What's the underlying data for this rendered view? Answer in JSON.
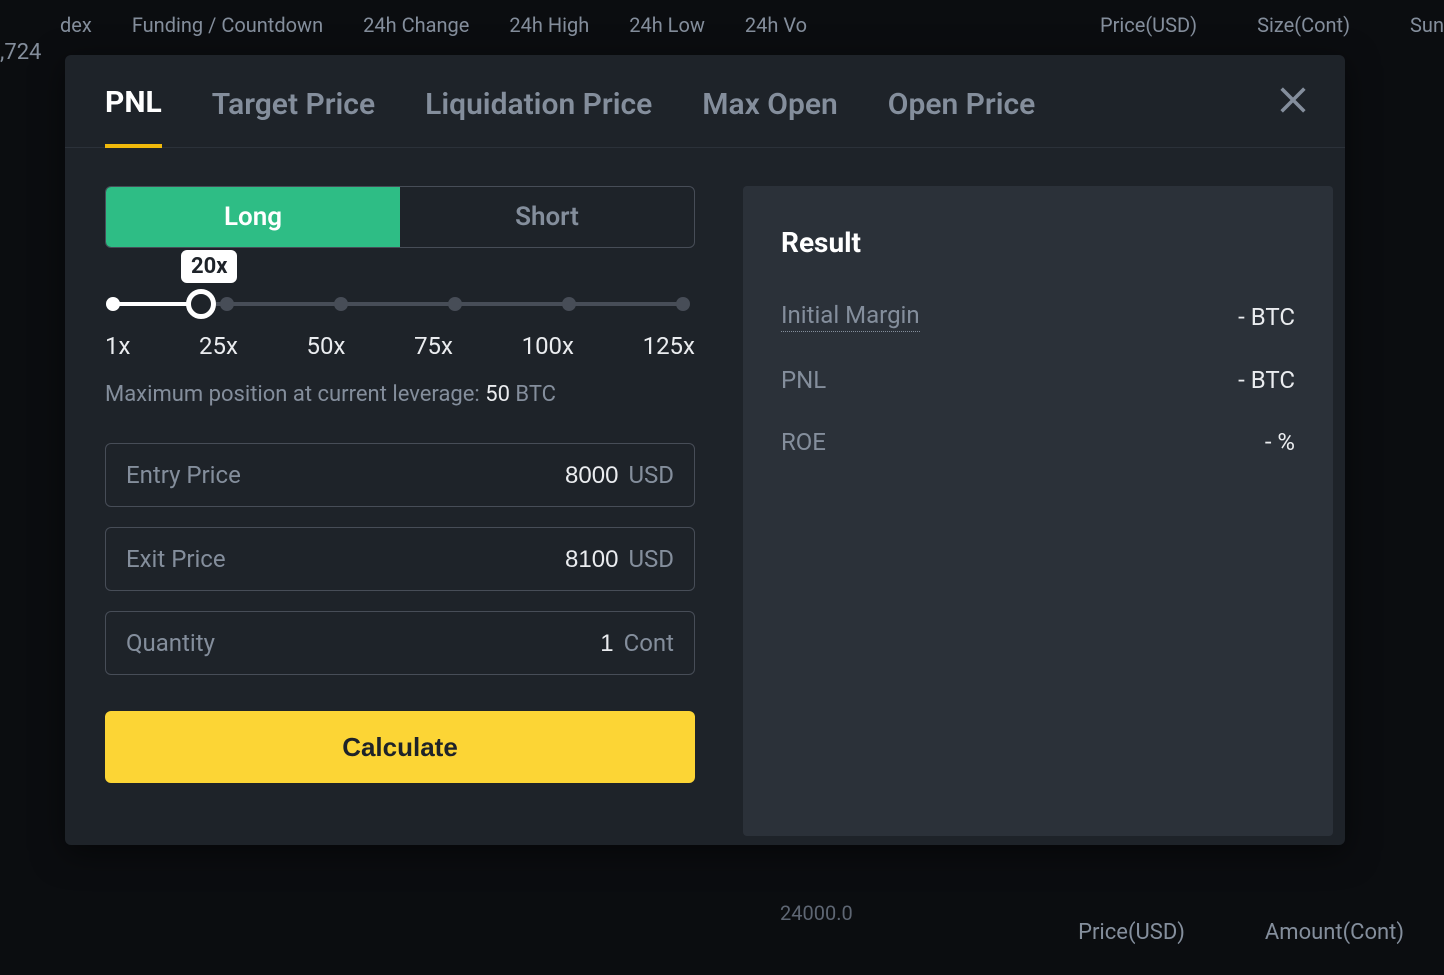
{
  "background": {
    "topCols": [
      "dex",
      "Funding / Countdown",
      "24h Change",
      "24h High",
      "24h Low",
      "24h Vo"
    ],
    "rightFrag": [
      "Price(USD)",
      "Size(Cont)",
      "Sun"
    ],
    "leftPrice": ",724",
    "bottomTick": "24000.0",
    "bottomCols": [
      "Price(USD)",
      "Amount(Cont)"
    ]
  },
  "modal": {
    "tabs": {
      "pnl": "PNL",
      "target": "Target Price",
      "liq": "Liquidation Price",
      "maxopen": "Max Open",
      "open": "Open Price"
    },
    "side": {
      "long": "Long",
      "short": "Short"
    },
    "leverage": {
      "value_label": "20x",
      "ticks": [
        "1x",
        "25x",
        "50x",
        "75x",
        "100x",
        "125x"
      ],
      "note_prefix": "Maximum position at current leverage: ",
      "note_value": "50",
      "note_unit": " BTC"
    },
    "inputs": {
      "entry": {
        "label": "Entry Price",
        "value": "8000",
        "unit": "USD"
      },
      "exit": {
        "label": "Exit Price",
        "value": "8100",
        "unit": "USD"
      },
      "qty": {
        "label": "Quantity",
        "value": "1",
        "unit": "Cont"
      }
    },
    "calc_label": "Calculate",
    "result": {
      "title": "Result",
      "rows": {
        "margin": {
          "label": "Initial Margin",
          "value": "- BTC"
        },
        "pnl": {
          "label": "PNL",
          "value": "- BTC"
        },
        "roe": {
          "label": "ROE",
          "value": "- %"
        }
      }
    }
  }
}
